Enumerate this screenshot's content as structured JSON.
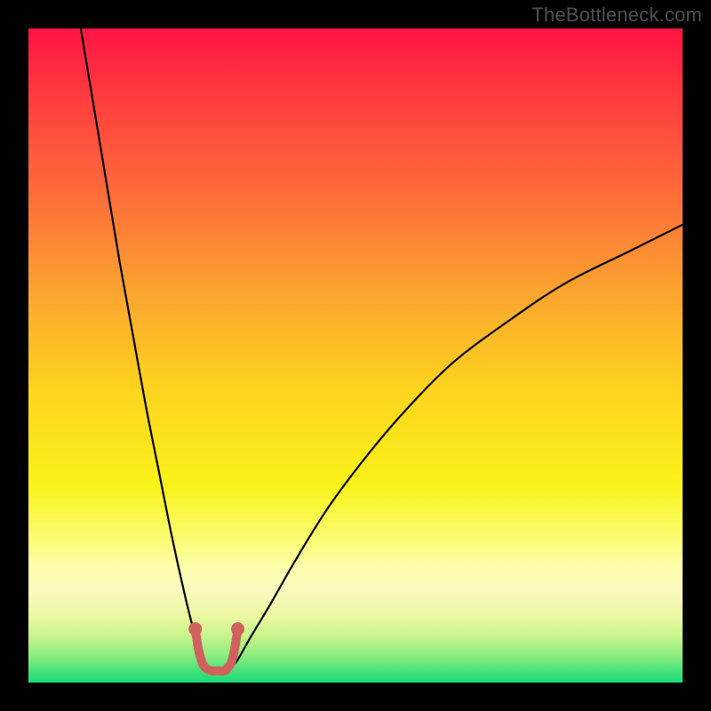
{
  "watermark": "TheBottleneck.com",
  "colors": {
    "frame": "#000000",
    "curve": "#000000",
    "salmon": "#cf615f",
    "gradient_stops": [
      {
        "offset": 0.0,
        "color": "#ff1443"
      },
      {
        "offset": 0.1,
        "color": "#ff3a3f"
      },
      {
        "offset": 0.25,
        "color": "#fd6b39"
      },
      {
        "offset": 0.4,
        "color": "#fca330"
      },
      {
        "offset": 0.55,
        "color": "#fdd31e"
      },
      {
        "offset": 0.7,
        "color": "#f9f31a"
      },
      {
        "offset": 0.78,
        "color": "#fbfc72"
      },
      {
        "offset": 0.82,
        "color": "#fdfda8"
      },
      {
        "offset": 0.86,
        "color": "#faf9c0"
      },
      {
        "offset": 0.9,
        "color": "#ebf8a0"
      },
      {
        "offset": 0.93,
        "color": "#c5f48a"
      },
      {
        "offset": 0.96,
        "color": "#8aec7e"
      },
      {
        "offset": 0.985,
        "color": "#3fe07a"
      },
      {
        "offset": 1.0,
        "color": "#17da78"
      }
    ]
  },
  "chart_data": {
    "type": "line",
    "title": "",
    "xlabel": "",
    "ylabel": "",
    "xlim": [
      0,
      100
    ],
    "ylim": [
      0,
      100
    ],
    "grid": false,
    "series": [
      {
        "name": "left-branch",
        "x": [
          8,
          10,
          12,
          14,
          16,
          18,
          20,
          22,
          24,
          25.5,
          26.5,
          27
        ],
        "y": [
          100,
          88,
          76,
          64,
          53,
          42,
          32,
          22,
          13,
          7,
          3.5,
          2.3
        ]
      },
      {
        "name": "right-branch",
        "x": [
          31,
          32,
          34,
          37,
          41,
          46,
          52,
          58,
          65,
          73,
          82,
          92,
          100
        ],
        "y": [
          2.3,
          3.5,
          7,
          12,
          19,
          27,
          35,
          42,
          49,
          55,
          61,
          66,
          70
        ]
      },
      {
        "name": "valley-salmon",
        "x": [
          25.5,
          26,
          26.5,
          27,
          28,
          29,
          30,
          30.5,
          31,
          31.5,
          32
        ],
        "y": [
          8.2,
          5,
          3.2,
          2.3,
          1.8,
          1.8,
          1.8,
          2.3,
          3,
          5,
          8.2
        ]
      }
    ],
    "annotations": [
      {
        "text": "TheBottleneck.com",
        "position": "top-right"
      }
    ]
  }
}
